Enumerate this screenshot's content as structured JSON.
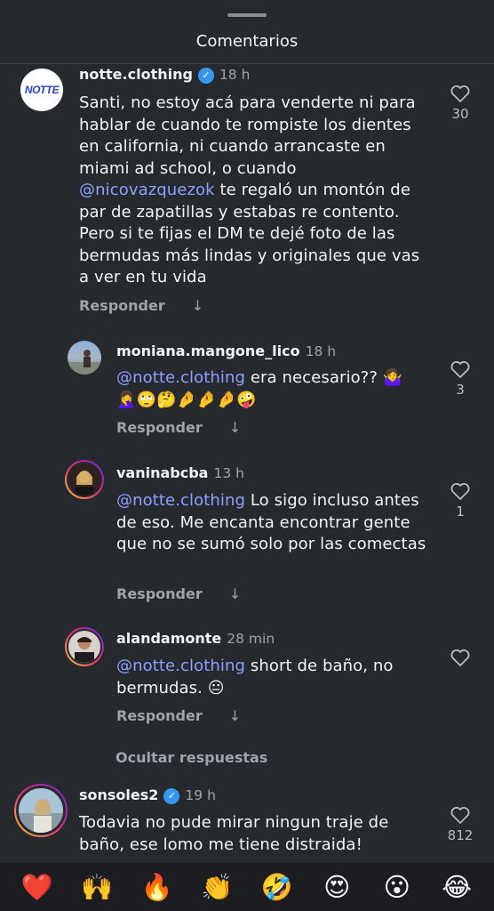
{
  "header": {
    "title": "Comentarios"
  },
  "comments": [
    {
      "username": "notte.clothing",
      "verified": true,
      "time": "18 h",
      "avatar_text": "NOTTE",
      "body": "Santi, no estoy acá para venderte ni para hablar de cuando te rompiste los dientes en california, ni cuando arrancaste en miami ad school, o cuando",
      "mention": "@nicovazquezok",
      "body_after": "te regaló un montón de par de zapatillas y estabas re contento. Pero si te fijas el DM te dejé foto de las bermudas más lindas y originales que vas a ver en tu vida",
      "reply_label": "Responder",
      "likes": "30"
    },
    {
      "username": "moniana.mangone_lico",
      "verified": false,
      "time": "18 h",
      "mention": "@notte.clothing",
      "body_after": "era necesario?? 🤷‍♀️",
      "emoji_line": "🤦‍♀️🙄🤔🤌🤌🤌🤪",
      "reply_label": "Responder",
      "likes": "3"
    },
    {
      "username": "vaninabcba",
      "verified": false,
      "time": "13 h",
      "mention": "@notte.clothing",
      "body_after": "Lo sigo incluso antes de eso. Me encanta encontrar gente que no se sumó solo por las comectas",
      "reply_label": "Responder",
      "likes": "1"
    },
    {
      "username": "alandamonte",
      "verified": false,
      "time": "28 min",
      "mention": "@notte.clothing",
      "body_after": "short de baño, no bermudas. 😐",
      "reply_label": "Responder",
      "likes": ""
    },
    {
      "username": "sonsoles2",
      "verified": true,
      "time": "19 h",
      "body": "Todavia no pude mirar ningun traje de baño, ese lomo me tiene distraida!",
      "likes": "812"
    }
  ],
  "hide_replies": "Ocultar respuestas",
  "reactions": [
    "❤️",
    "🙌",
    "🔥",
    "👏",
    "🤣",
    "😍",
    "😮",
    "😂"
  ],
  "colors": {
    "background": "#262a2f",
    "mention": "#8ea0ff",
    "verified": "#3797f0",
    "muted": "#a0a4aa"
  }
}
